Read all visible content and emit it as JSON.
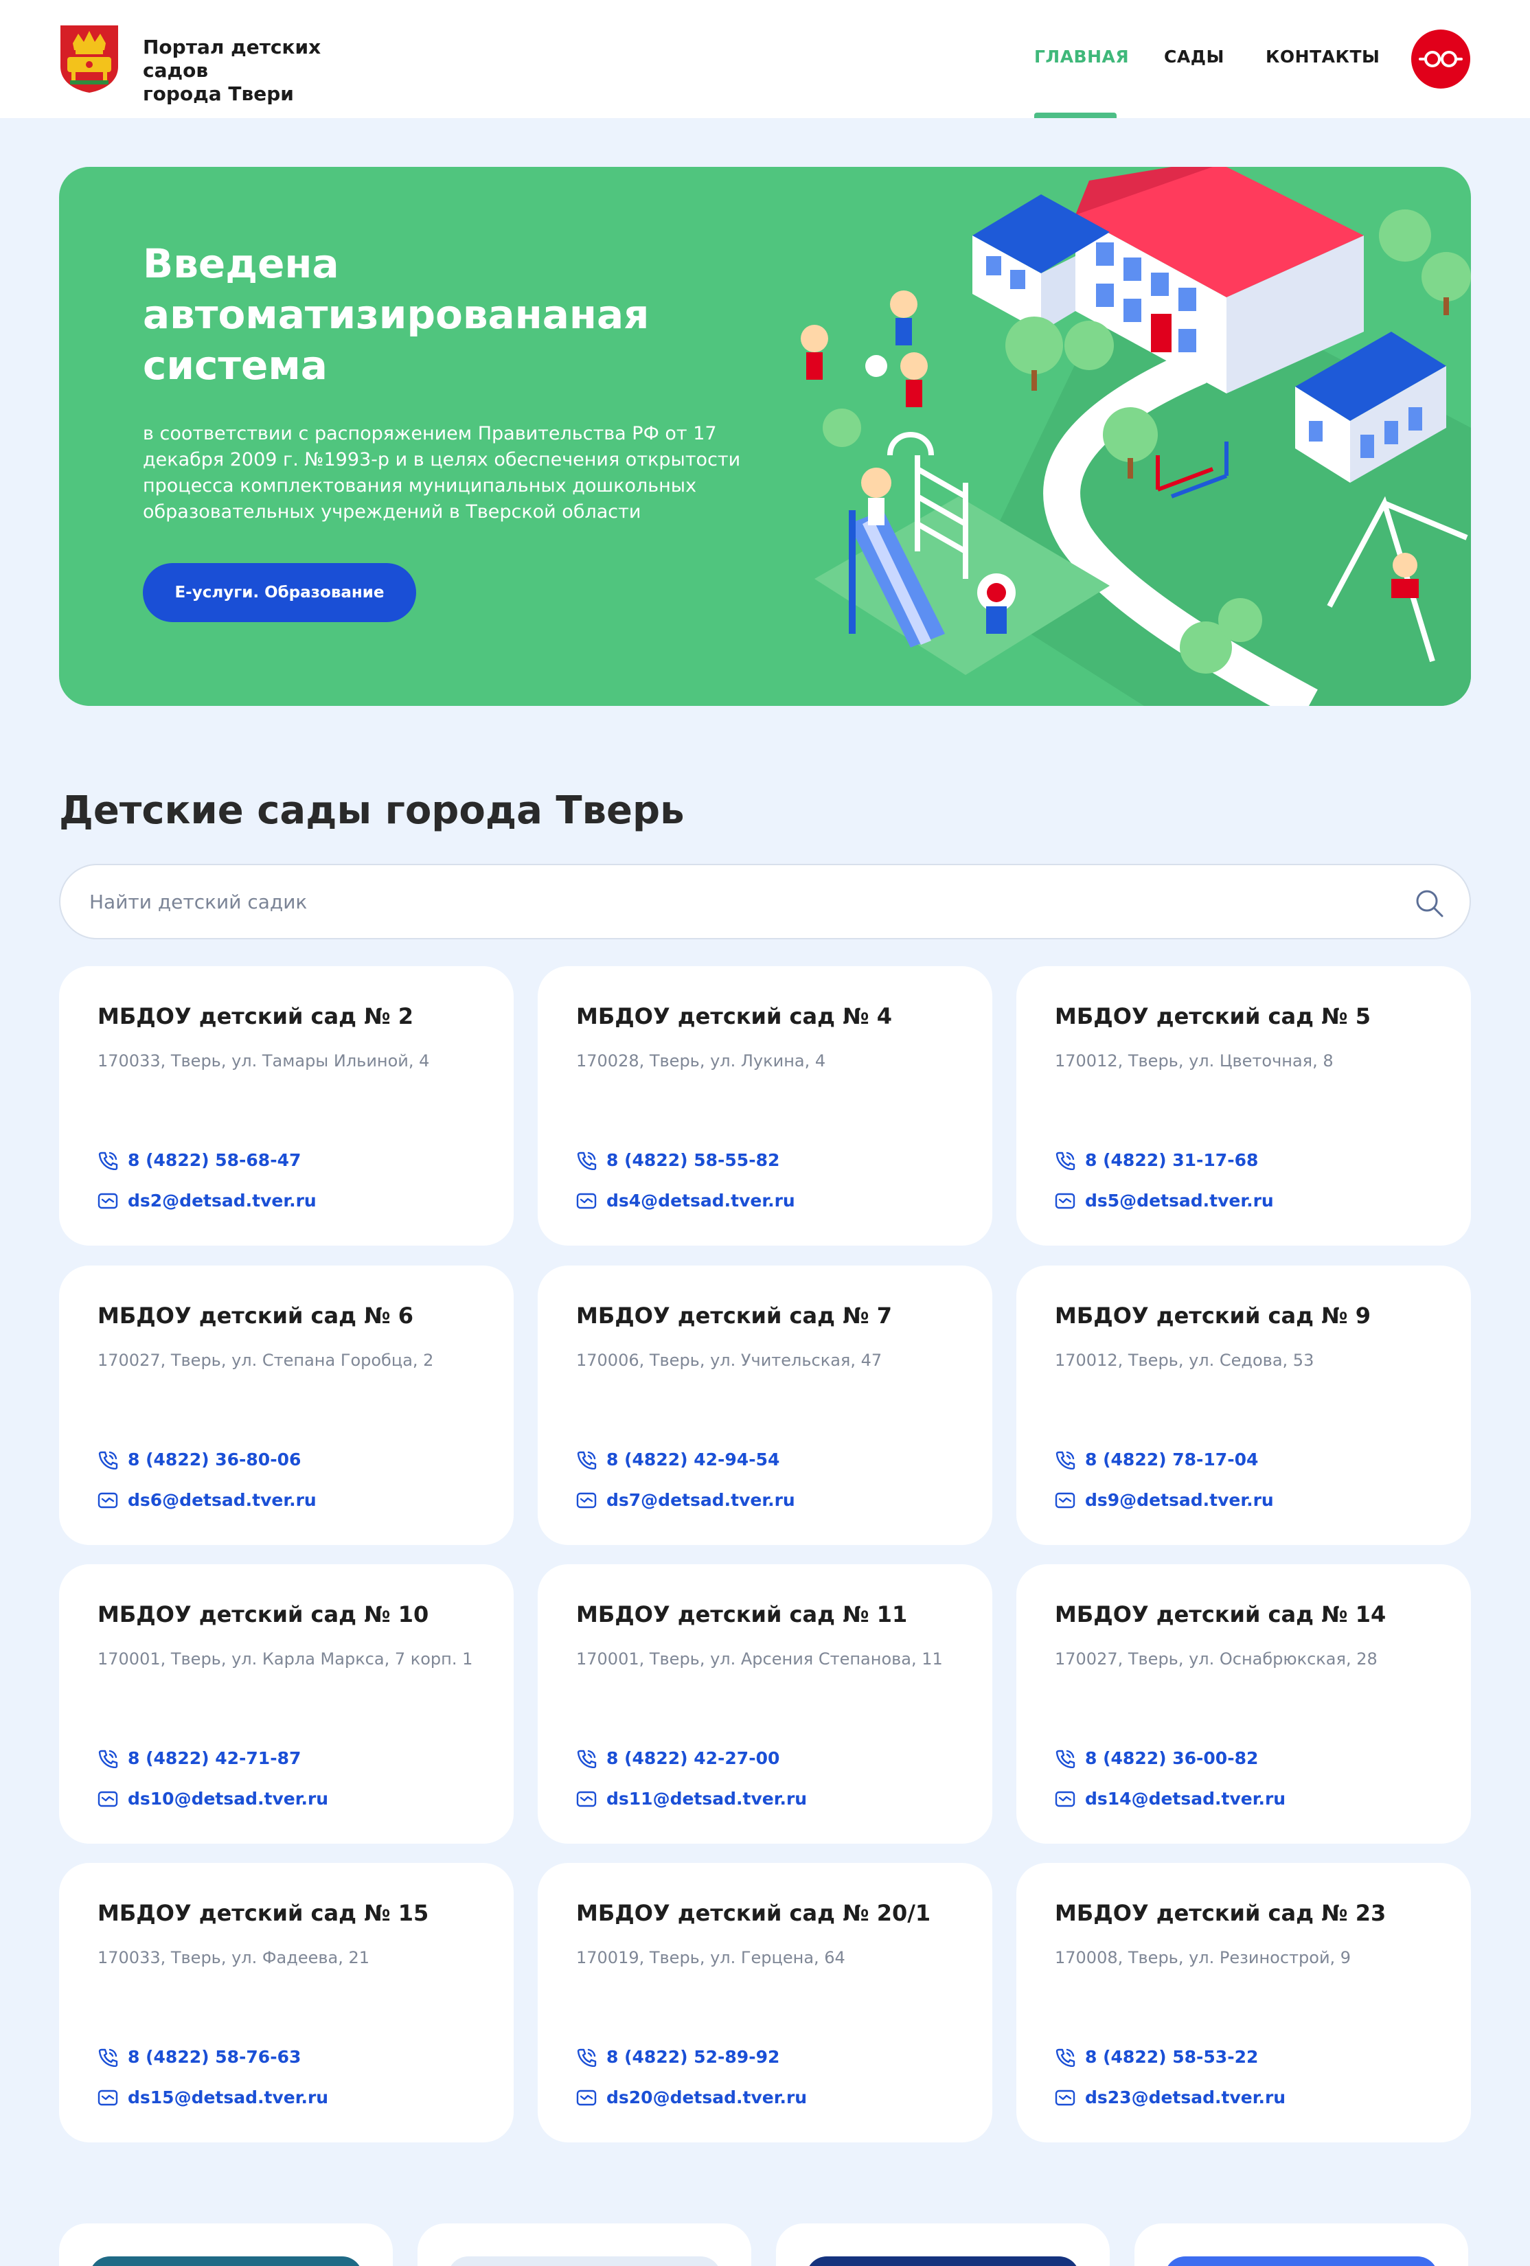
{
  "header": {
    "title_line1": "Портал детских садов",
    "title_line2": "города Твери",
    "nav": [
      "ГЛАВНАЯ",
      "САДЫ",
      "КОНТАКТЫ"
    ],
    "active_nav": "ГЛАВНАЯ",
    "accessibility_icon": "glasses-icon"
  },
  "hero": {
    "title": "Введена автоматизировананая система",
    "text": "в соответствии с распоряжением Правительства РФ от 17 декабря 2009 г. №1993-р и в целях обеспечения открытости процесса комплектования муниципальных дошкольных образовательных учреждений в Тверской области",
    "button": "Е-услуги. Образование"
  },
  "section": {
    "title": "Детские сады города Тверь",
    "search_placeholder": "Найти детский садик"
  },
  "kindergartens": [
    {
      "name": "МБДОУ детский сад № 2",
      "address": "170033, Тверь, ул. Тамары Ильиной, 4",
      "phone": "8 (4822) 58-68-47",
      "email": "ds2@detsad.tver.ru"
    },
    {
      "name": "МБДОУ детский сад № 4",
      "address": "170028, Тверь, ул. Лукина, 4",
      "phone": "8 (4822) 58-55-82",
      "email": "ds4@detsad.tver.ru"
    },
    {
      "name": "МБДОУ детский сад № 5",
      "address": "170012, Тверь, ул. Цветочная, 8",
      "phone": "8 (4822) 31-17-68",
      "email": "ds5@detsad.tver.ru"
    },
    {
      "name": "МБДОУ детский сад № 6",
      "address": "170027, Тверь, ул. Степана Горобца, 2",
      "phone": "8 (4822) 36-80-06",
      "email": "ds6@detsad.tver.ru"
    },
    {
      "name": "МБДОУ детский сад № 7",
      "address": "170006, Тверь, ул. Учительская, 47",
      "phone": "8 (4822) 42-94-54",
      "email": "ds7@detsad.tver.ru"
    },
    {
      "name": "МБДОУ детский сад № 9",
      "address": "170012, Тверь, ул. Седова, 53",
      "phone": "8 (4822) 78-17-04",
      "email": "ds9@detsad.tver.ru"
    },
    {
      "name": "МБДОУ детский сад № 10",
      "address": "170001, Тверь, ул. Карла Маркса, 7 корп. 1",
      "phone": "8 (4822) 42-71-87",
      "email": "ds10@detsad.tver.ru"
    },
    {
      "name": "МБДОУ детский сад № 11",
      "address": "170001, Тверь, ул. Арсения Степанова, 11",
      "phone": "8 (4822) 42-27-00",
      "email": "ds11@detsad.tver.ru"
    },
    {
      "name": "МБДОУ детский сад № 14",
      "address": "170027, Тверь, ул. Оснабрюкская, 28",
      "phone": "8 (4822) 36-00-82",
      "email": "ds14@detsad.tver.ru"
    },
    {
      "name": "МБДОУ детский сад № 15",
      "address": "170033, Тверь, ул. Фадеева, 21",
      "phone": "8 (4822) 58-76-63",
      "email": "ds15@detsad.tver.ru"
    },
    {
      "name": "МБДОУ детский сад № 20/1",
      "address": "170019, Тверь, ул. Герцена, 64",
      "phone": "8 (4822) 52-89-92",
      "email": "ds20@detsad.tver.ru"
    },
    {
      "name": "МБДОУ детский сад № 23",
      "address": "170008, Тверь, ул. Резинострой, 9",
      "phone": "8 (4822) 58-53-22",
      "email": "ds23@detsad.tver.ru"
    }
  ],
  "colors": {
    "page_bg": "#ecf3fd",
    "hero_green": "#50c57e",
    "accent_blue": "#1a4fd6",
    "nav_active": "#3fb87a",
    "accessibility_red": "#e1001a",
    "bottom_chips": [
      "#1f6a86",
      "#e4ecf7",
      "#15337e",
      "#3d6df0"
    ]
  }
}
